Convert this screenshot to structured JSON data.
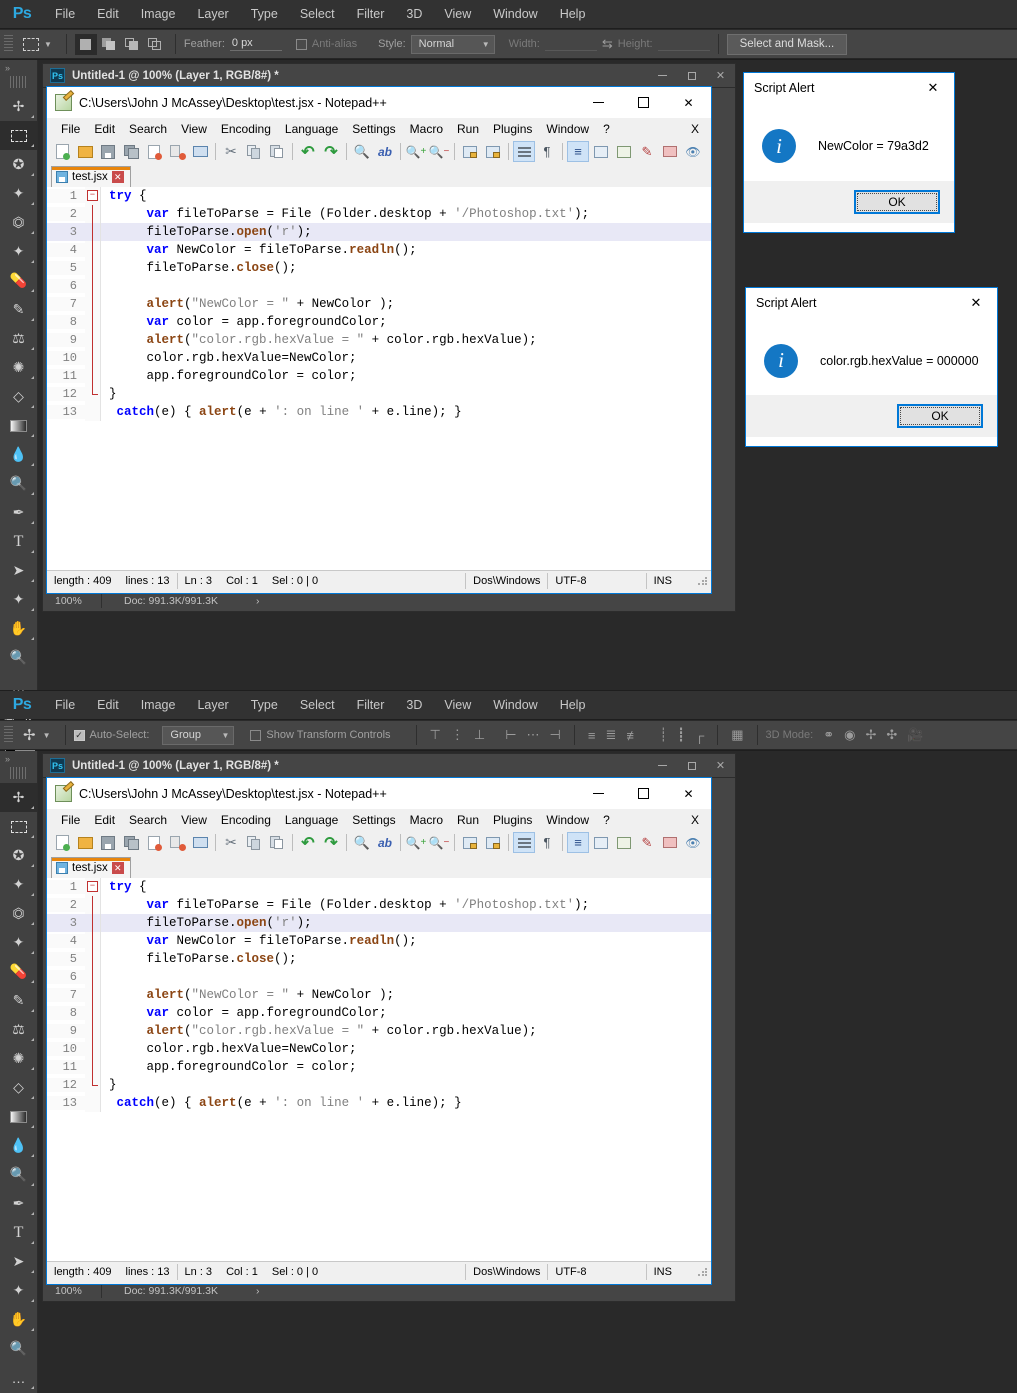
{
  "photoshop": {
    "logo": "Ps",
    "menu": [
      "File",
      "Edit",
      "Image",
      "Layer",
      "Type",
      "Select",
      "Filter",
      "3D",
      "View",
      "Window",
      "Help"
    ],
    "options_top": {
      "tool_icon": "rectangular-marquee-icon",
      "feather_label": "Feather:",
      "feather_value": "0 px",
      "antialias_label": "Anti-alias",
      "antialias_checked": false,
      "style_label": "Style:",
      "style_value": "Normal",
      "width_label": "Width:",
      "width_value": "",
      "height_label": "Height:",
      "height_value": "",
      "swap_icon": "swap-arrows-icon",
      "select_and_mask": "Select and Mask..."
    },
    "options_bottom": {
      "tool_icon": "move-tool-icon",
      "autoselect_label": "Auto-Select:",
      "autoselect_checked": true,
      "autoselect_value": "Group",
      "transform_label": "Show Transform Controls",
      "transform_checked": false,
      "mode3d_label": "3D Mode:"
    },
    "tools": [
      "move-tool-icon",
      "rectangular-marquee-icon",
      "lasso-tool-icon",
      "magic-wand-icon",
      "crop-tool-icon",
      "eyedropper-icon",
      "healing-brush-icon",
      "brush-tool-icon",
      "clone-stamp-icon",
      "history-brush-icon",
      "eraser-tool-icon",
      "gradient-tool-icon",
      "blur-tool-icon",
      "dodge-tool-icon",
      "pen-tool-icon",
      "type-tool-icon",
      "path-selection-icon",
      "custom-shape-icon",
      "hand-tool-icon",
      "zoom-tool-icon",
      "more-tools-icon",
      "quick-mask-icon",
      "screen-mode-icon"
    ],
    "document_title": "Untitled-1 @ 100% (Layer 1, RGB/8#) *",
    "status": {
      "zoom": "100%",
      "doc": "Doc: 991.3K/991.3K",
      "arrow": "›"
    }
  },
  "notepad": {
    "title": "C:\\Users\\John J McAssey\\Desktop\\test.jsx - Notepad++",
    "menu": [
      "File",
      "Edit",
      "Search",
      "View",
      "Encoding",
      "Language",
      "Settings",
      "Macro",
      "Run",
      "Plugins",
      "Window",
      "?"
    ],
    "menu_close": "X",
    "toolbar_icons": [
      "new-file-icon",
      "open-file-icon",
      "save-icon",
      "save-all-icon",
      "close-file-icon",
      "close-all-icon",
      "print-icon",
      "cut-icon",
      "copy-icon",
      "paste-icon",
      "undo-icon",
      "redo-icon",
      "find-icon",
      "replace-icon",
      "zoom-in-icon",
      "zoom-out-icon",
      "sync-vertical-icon",
      "sync-horizontal-icon",
      "word-wrap-icon",
      "show-all-chars-icon",
      "indent-guide-icon",
      "user-defined-dialog-icon",
      "show-doc-map-icon",
      "function-list-icon",
      "folder-workspace-icon",
      "monitoring-icon"
    ],
    "tab": {
      "label": "test.jsx",
      "close": "✕",
      "save_icon": "save-icon"
    },
    "window_buttons": {
      "minimize": "minimize-icon",
      "maximize": "maximize-icon",
      "close": "✕"
    },
    "code_lines": [
      {
        "num": "1",
        "fold": "open",
        "segments": [
          {
            "t": "try",
            "c": "k"
          },
          {
            "t": " {",
            "c": ""
          }
        ]
      },
      {
        "num": "2",
        "fold": "bar",
        "segments": [
          {
            "t": "     ",
            "c": ""
          },
          {
            "t": "var",
            "c": "k"
          },
          {
            "t": " fileToParse = File (Folder.desktop + ",
            "c": ""
          },
          {
            "t": "'/Photoshop.txt'",
            "c": "s"
          },
          {
            "t": ");",
            "c": ""
          }
        ]
      },
      {
        "num": "3",
        "fold": "bar",
        "hl": true,
        "segments": [
          {
            "t": "     fileToParse.",
            "c": ""
          },
          {
            "t": "open",
            "c": "f"
          },
          {
            "t": "(",
            "c": ""
          },
          {
            "t": "'r'",
            "c": "s"
          },
          {
            "t": ");",
            "c": ""
          }
        ]
      },
      {
        "num": "4",
        "fold": "bar",
        "segments": [
          {
            "t": "     ",
            "c": ""
          },
          {
            "t": "var",
            "c": "k"
          },
          {
            "t": " NewColor = fileToParse.",
            "c": ""
          },
          {
            "t": "readln",
            "c": "f"
          },
          {
            "t": "();",
            "c": ""
          }
        ]
      },
      {
        "num": "5",
        "fold": "bar",
        "segments": [
          {
            "t": "     fileToParse.",
            "c": ""
          },
          {
            "t": "close",
            "c": "f"
          },
          {
            "t": "();",
            "c": ""
          }
        ]
      },
      {
        "num": "6",
        "fold": "bar",
        "segments": [
          {
            "t": "",
            "c": ""
          }
        ]
      },
      {
        "num": "7",
        "fold": "bar",
        "segments": [
          {
            "t": "     ",
            "c": ""
          },
          {
            "t": "alert",
            "c": "f"
          },
          {
            "t": "(",
            "c": ""
          },
          {
            "t": "\"NewColor = \"",
            "c": "s"
          },
          {
            "t": " + NewColor );",
            "c": ""
          }
        ]
      },
      {
        "num": "8",
        "fold": "bar",
        "segments": [
          {
            "t": "     ",
            "c": ""
          },
          {
            "t": "var",
            "c": "k"
          },
          {
            "t": " color = app.foregroundColor;",
            "c": ""
          }
        ]
      },
      {
        "num": "9",
        "fold": "bar",
        "segments": [
          {
            "t": "     ",
            "c": ""
          },
          {
            "t": "alert",
            "c": "f"
          },
          {
            "t": "(",
            "c": ""
          },
          {
            "t": "\"color.rgb.hexValue = \"",
            "c": "s"
          },
          {
            "t": " + color.rgb.hexValue);",
            "c": ""
          }
        ]
      },
      {
        "num": "10",
        "fold": "bar",
        "segments": [
          {
            "t": "     color.rgb.hexValue=NewColor;",
            "c": ""
          }
        ]
      },
      {
        "num": "11",
        "fold": "bar",
        "segments": [
          {
            "t": "     app.foregroundColor = color;",
            "c": ""
          }
        ]
      },
      {
        "num": "12",
        "fold": "end",
        "segments": [
          {
            "t": "}",
            "c": ""
          }
        ]
      },
      {
        "num": "13",
        "fold": "none",
        "segments": [
          {
            "t": " ",
            "c": ""
          },
          {
            "t": "catch",
            "c": "k"
          },
          {
            "t": "(e) { ",
            "c": ""
          },
          {
            "t": "alert",
            "c": "f"
          },
          {
            "t": "(e + ",
            "c": ""
          },
          {
            "t": "': on line '",
            "c": "s"
          },
          {
            "t": " + e.line); }",
            "c": ""
          }
        ]
      }
    ],
    "status": {
      "length": "length : 409",
      "lines": "lines : 13",
      "ln": "Ln : 3",
      "col": "Col : 1",
      "sel": "Sel : 0 | 0",
      "eol": "Dos\\Windows",
      "encoding": "UTF-8",
      "insert": "INS"
    }
  },
  "dialogs": [
    {
      "title": "Script Alert",
      "message": "NewColor = 79a3d2",
      "ok": "OK",
      "close": "✕",
      "icon": "info-icon"
    },
    {
      "title": "Script Alert",
      "message": "color.rgb.hexValue = 000000",
      "ok": "OK",
      "close": "✕",
      "icon": "info-icon"
    }
  ],
  "colors": {
    "accent": "#0078d7",
    "info_blue": "#1477c4",
    "ps_chrome": "#323232",
    "tab_active": "#e8850c"
  }
}
